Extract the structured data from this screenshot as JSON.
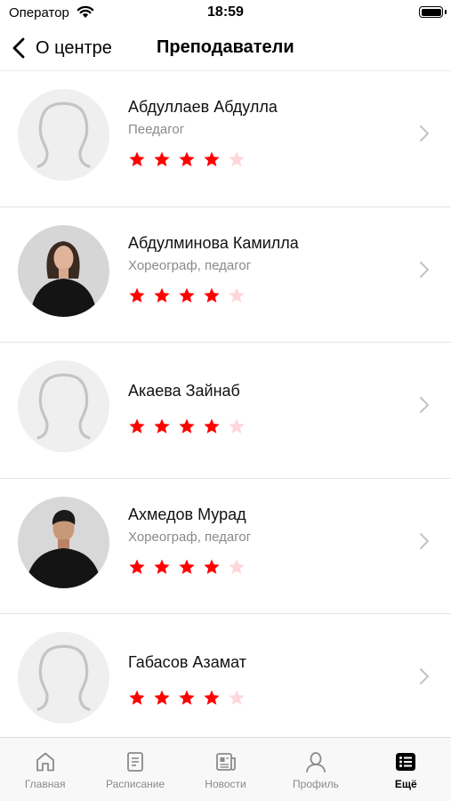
{
  "status_bar": {
    "carrier": "Оператор",
    "time": "18:59"
  },
  "nav": {
    "back_label": "О центре",
    "title": "Преподаватели"
  },
  "colors": {
    "star_filled": "#ff0000",
    "star_empty": "#ffd6d9",
    "accent": "#000000"
  },
  "teachers": [
    {
      "name": "Абдуллаев Абдулла",
      "role": "Пеедагог",
      "rating": 4,
      "max_rating": 5,
      "avatar": "placeholder"
    },
    {
      "name": "Абдулминова Камилла",
      "role": "Хореограф, педагог",
      "rating": 4,
      "max_rating": 5,
      "avatar": "photo-woman"
    },
    {
      "name": "Акаева Зайнаб",
      "role": "",
      "rating": 4,
      "max_rating": 5,
      "avatar": "placeholder"
    },
    {
      "name": "Ахмедов Мурад",
      "role": "Хореограф, педагог",
      "rating": 4,
      "max_rating": 5,
      "avatar": "photo-man"
    },
    {
      "name": "Габасов Азамат",
      "role": "",
      "rating": 4,
      "max_rating": 5,
      "avatar": "placeholder"
    }
  ],
  "tabs": [
    {
      "label": "Главная",
      "icon": "home-icon",
      "active": false
    },
    {
      "label": "Расписание",
      "icon": "schedule-icon",
      "active": false
    },
    {
      "label": "Новости",
      "icon": "news-icon",
      "active": false
    },
    {
      "label": "Профиль",
      "icon": "profile-icon",
      "active": false
    },
    {
      "label": "Ещё",
      "icon": "more-icon",
      "active": true
    }
  ]
}
